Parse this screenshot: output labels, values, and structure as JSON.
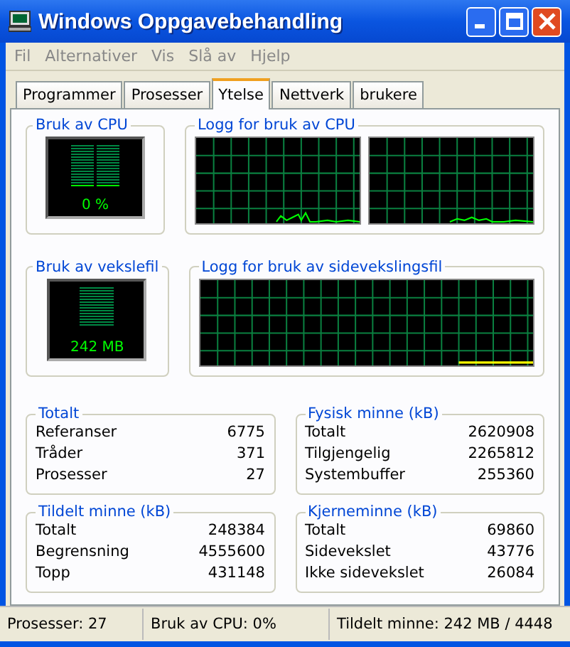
{
  "window": {
    "title": "Windows Oppgavebehandling"
  },
  "menu": [
    "Fil",
    "Alternativer",
    "Vis",
    "Slå av",
    "Hjelp"
  ],
  "tabs": [
    {
      "label": "Programmer",
      "selected": false
    },
    {
      "label": "Prosesser",
      "selected": false
    },
    {
      "label": "Ytelse",
      "selected": true
    },
    {
      "label": "Nettverk",
      "selected": false
    },
    {
      "label": "brukere",
      "selected": false
    }
  ],
  "cpu_usage": {
    "title": "Bruk av CPU",
    "reading": "0 %"
  },
  "cpu_history": {
    "title": "Logg for bruk av CPU"
  },
  "pagefile_usage": {
    "title": "Bruk av vekslefil",
    "reading": "242 MB"
  },
  "pagefile_history": {
    "title": "Logg for bruk av sidevekslingsfil"
  },
  "stat_groups": [
    {
      "title": "Totalt",
      "rows": [
        {
          "label": "Referanser",
          "value": "6775"
        },
        {
          "label": "Tråder",
          "value": "371"
        },
        {
          "label": "Prosesser",
          "value": "27"
        }
      ]
    },
    {
      "title": "Fysisk minne (kB)",
      "rows": [
        {
          "label": "Totalt",
          "value": "2620908"
        },
        {
          "label": "Tilgjengelig",
          "value": "2265812"
        },
        {
          "label": "Systembuffer",
          "value": "255360"
        }
      ]
    },
    {
      "title": "Tildelt minne (kB)",
      "rows": [
        {
          "label": "Totalt",
          "value": "248384"
        },
        {
          "label": "Begrensning",
          "value": "4555600"
        },
        {
          "label": "Topp",
          "value": "431148"
        }
      ]
    },
    {
      "title": "Kjerneminne (kB)",
      "rows": [
        {
          "label": "Totalt",
          "value": "69860"
        },
        {
          "label": "Sidevekslet",
          "value": "43776"
        },
        {
          "label": "Ikke sidevekslet",
          "value": "26084"
        }
      ]
    }
  ],
  "status_bar": [
    "Prosesser: 27",
    "Bruk av CPU: 0%",
    "Tildelt minne: 242 MB / 4448"
  ]
}
